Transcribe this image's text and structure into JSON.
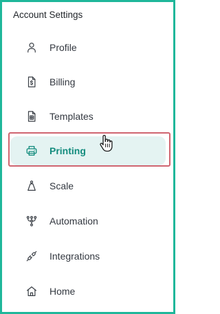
{
  "header": {
    "title": "Account Settings"
  },
  "menu": {
    "items": [
      {
        "label": "Profile",
        "icon": "user-icon"
      },
      {
        "label": "Billing",
        "icon": "billing-icon"
      },
      {
        "label": "Templates",
        "icon": "templates-icon"
      },
      {
        "label": "Printing",
        "icon": "printer-icon",
        "active": true
      },
      {
        "label": "Scale",
        "icon": "scale-icon"
      },
      {
        "label": "Automation",
        "icon": "automation-icon"
      },
      {
        "label": "Integrations",
        "icon": "integrations-icon"
      },
      {
        "label": "Home",
        "icon": "home-icon"
      }
    ]
  },
  "colors": {
    "frame_border": "#1fb79a",
    "active_text": "#148c7e",
    "active_bg": "#e4f3f2",
    "highlight_border": "#cf6570"
  }
}
